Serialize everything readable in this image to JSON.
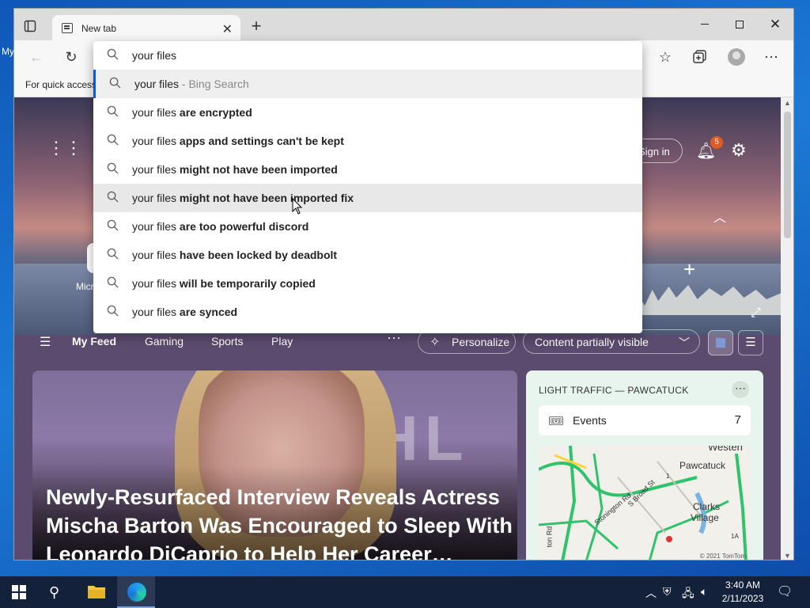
{
  "desktop": {
    "icon_label": "My"
  },
  "browser": {
    "tab_title": "New tab",
    "favorites_bar_text": "For quick access"
  },
  "ntp": {
    "sign_in": "Sign in",
    "notification_count": "5",
    "tile_label": "Micr",
    "feed_nav": {
      "my_feed": "My Feed",
      "gaming": "Gaming",
      "sports": "Sports",
      "play": "Play",
      "personalize": "Personalize",
      "content_visibility": "Content partially visible"
    },
    "headline": {
      "background_text": "HL",
      "title": "Newly-Resurfaced Interview Reveals Actress Mischa Barton Was Encouraged to Sleep With Leonardo DiCaprio to Help Her Career…"
    },
    "traffic": {
      "title": "LIGHT TRAFFIC — PAWCATUCK",
      "events_label": "Events",
      "events_count": "7",
      "map_places": {
        "westerly": "Westerl",
        "pawcatuck": "Pawcatuck",
        "clarks": "Clarks",
        "village": "Village",
        "stonington_rd": "Stonington Rd",
        "s_broad_st": "S Broad St",
        "ston_rd": "ton Rd",
        "route_1a": "1A",
        "route_1": "1"
      },
      "map_credit": "© 2021 TomTom"
    }
  },
  "omnibox": {
    "query": "your files",
    "suggestions": [
      {
        "prefix": "your files",
        "rest": "",
        "suffix": " - Bing Search"
      },
      {
        "prefix": "your files ",
        "rest": "are encrypted",
        "suffix": ""
      },
      {
        "prefix": "your files ",
        "rest": "apps and settings can't be kept",
        "suffix": ""
      },
      {
        "prefix": "your files ",
        "rest": "might not have been imported",
        "suffix": ""
      },
      {
        "prefix": "your files ",
        "rest": "might not have been imported fix",
        "suffix": ""
      },
      {
        "prefix": "your files ",
        "rest": "are too powerful discord",
        "suffix": ""
      },
      {
        "prefix": "your files ",
        "rest": "have been locked by deadbolt",
        "suffix": ""
      },
      {
        "prefix": "your files ",
        "rest": "will be temporarily copied",
        "suffix": ""
      },
      {
        "prefix": "your files ",
        "rest": "are synced",
        "suffix": ""
      }
    ]
  },
  "taskbar": {
    "time": "3:40 AM",
    "date": "2/11/2023"
  }
}
